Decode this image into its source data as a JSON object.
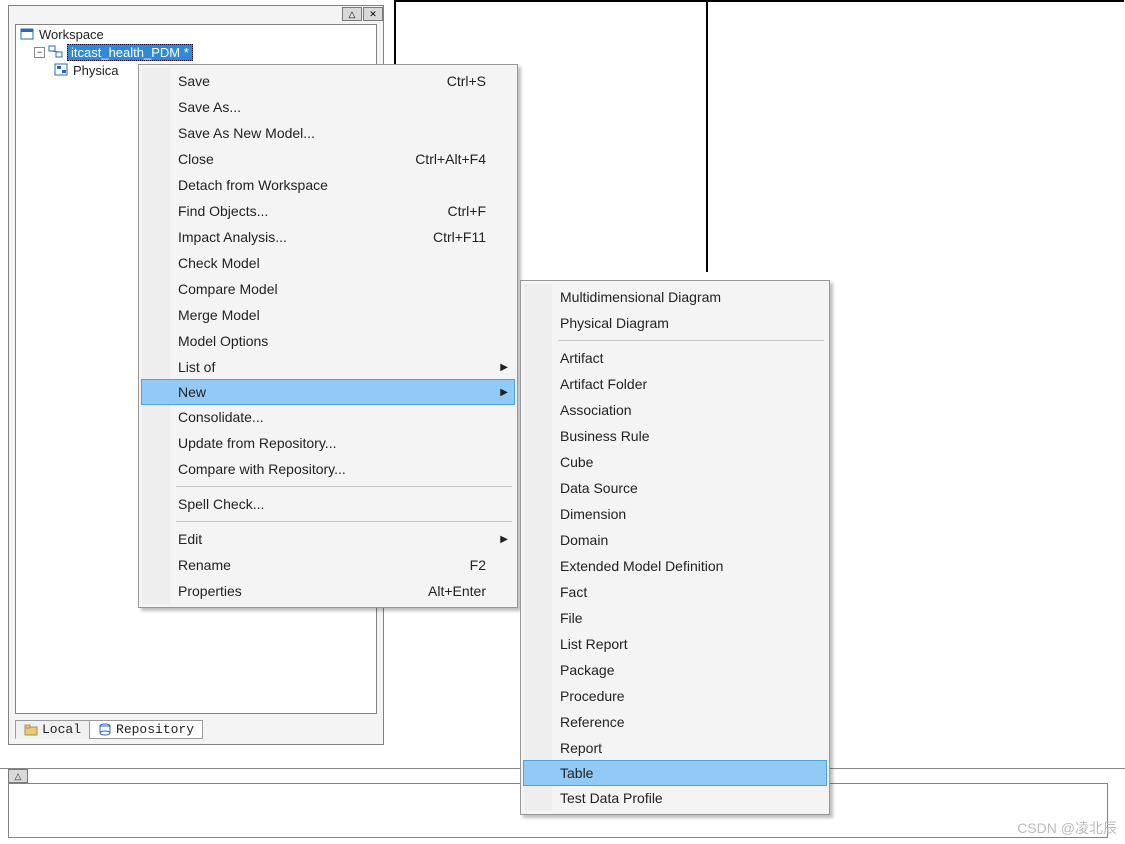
{
  "tree": {
    "root": "Workspace",
    "item_selected": "itcast_health_PDM *",
    "child": "Physica"
  },
  "bottom_tabs": {
    "local": "Local",
    "repository": "Repository"
  },
  "titlebar": {
    "pin": "△",
    "close": "✕"
  },
  "ctx_main": [
    {
      "label": "Save",
      "shortcut": "Ctrl+S"
    },
    {
      "label": "Save As..."
    },
    {
      "label": "Save As New Model..."
    },
    {
      "label": "Close",
      "shortcut": "Ctrl+Alt+F4"
    },
    {
      "label": "Detach from Workspace"
    },
    {
      "label": "Find Objects...",
      "shortcut": "Ctrl+F"
    },
    {
      "label": "Impact Analysis...",
      "shortcut": "Ctrl+F11"
    },
    {
      "label": "Check Model"
    },
    {
      "label": "Compare Model"
    },
    {
      "label": "Merge Model"
    },
    {
      "label": "Model Options"
    },
    {
      "label": "List of",
      "submenu": true
    },
    {
      "label": "New",
      "submenu": true,
      "hover": true
    },
    {
      "label": "Consolidate..."
    },
    {
      "label": "Update from Repository..."
    },
    {
      "label": "Compare with Repository..."
    },
    {
      "sep": true
    },
    {
      "label": "Spell Check..."
    },
    {
      "sep": true
    },
    {
      "label": "Edit",
      "submenu": true
    },
    {
      "label": "Rename",
      "shortcut": "F2"
    },
    {
      "label": "Properties",
      "shortcut": "Alt+Enter"
    }
  ],
  "ctx_sub": [
    {
      "label": "Multidimensional Diagram"
    },
    {
      "label": "Physical Diagram"
    },
    {
      "sep": true
    },
    {
      "label": "Artifact"
    },
    {
      "label": "Artifact Folder"
    },
    {
      "label": "Association"
    },
    {
      "label": "Business Rule"
    },
    {
      "label": "Cube"
    },
    {
      "label": "Data Source"
    },
    {
      "label": "Dimension"
    },
    {
      "label": "Domain"
    },
    {
      "label": "Extended Model Definition"
    },
    {
      "label": "Fact"
    },
    {
      "label": "File"
    },
    {
      "label": "List Report"
    },
    {
      "label": "Package"
    },
    {
      "label": "Procedure"
    },
    {
      "label": "Reference"
    },
    {
      "label": "Report"
    },
    {
      "label": "Table",
      "hover": true
    },
    {
      "label": "Test Data Profile"
    }
  ],
  "watermark": "CSDN @凌北辰"
}
